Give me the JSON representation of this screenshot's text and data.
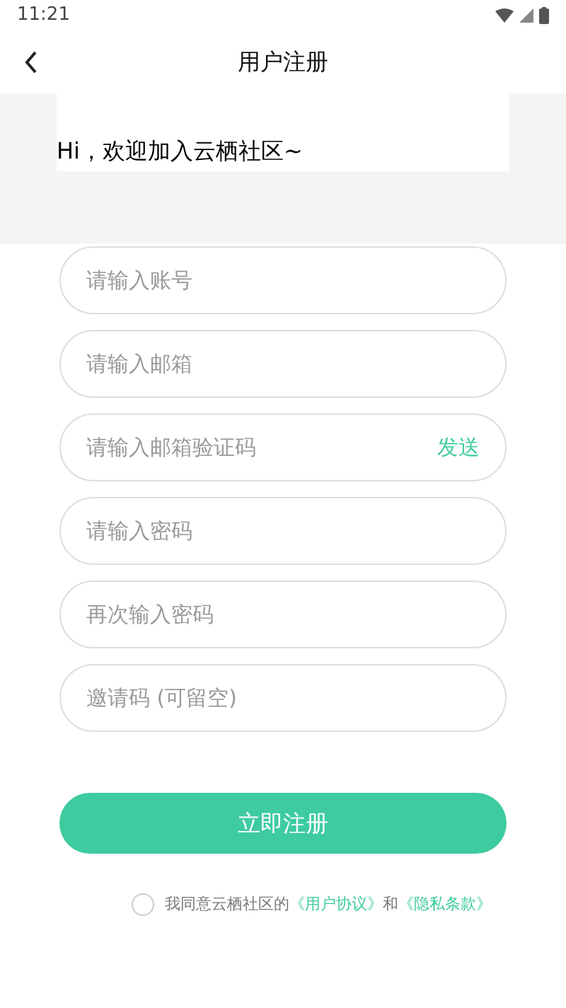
{
  "status_bar": {
    "time": "11:21"
  },
  "header": {
    "title": "用户注册"
  },
  "banner": {
    "greeting": "Hi，欢迎加入云栖社区~"
  },
  "fields": [
    {
      "placeholder": "请输入账号"
    },
    {
      "placeholder": "请输入邮箱"
    },
    {
      "placeholder": "请输入邮箱验证码",
      "action": "发送"
    },
    {
      "placeholder": "请输入密码"
    },
    {
      "placeholder": "再次输入密码"
    },
    {
      "placeholder": "邀请码 (可留空)"
    }
  ],
  "submit": {
    "label": "立即注册"
  },
  "agreement": {
    "checked": false,
    "parts": [
      {
        "kind": "text",
        "text": "我同意云栖社区的"
      },
      {
        "kind": "link",
        "text": "《用户协议》"
      },
      {
        "kind": "text",
        "text": "和"
      },
      {
        "kind": "link",
        "text": "《隐私条款》"
      }
    ]
  }
}
